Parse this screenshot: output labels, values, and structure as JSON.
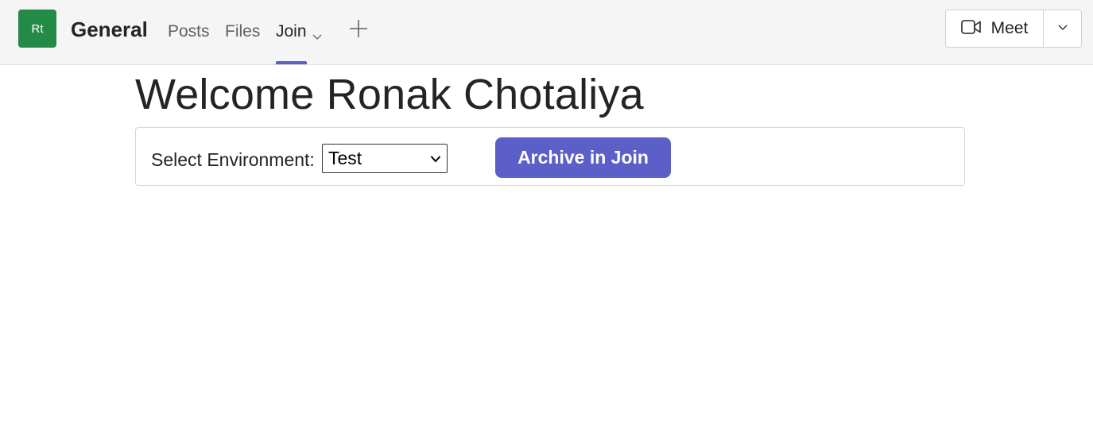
{
  "header": {
    "team_initials": "Rt",
    "channel_name": "General",
    "tabs": [
      {
        "label": "Posts",
        "active": false
      },
      {
        "label": "Files",
        "active": false
      },
      {
        "label": "Join",
        "active": true
      }
    ],
    "meet_label": "Meet"
  },
  "main": {
    "welcome_text": "Welcome Ronak Chotaliya",
    "environment_label": "Select Environment:",
    "environment_selected": "Test",
    "archive_button_label": "Archive in Join"
  },
  "colors": {
    "accent": "#5b5fc7",
    "team_avatar": "#238a47",
    "topbar_bg": "#f5f5f5"
  },
  "icons": {
    "add_tab": "plus-icon",
    "meet": "video-camera-icon",
    "meet_dropdown": "chevron-down-icon",
    "join_tab_dropdown": "chevron-down-icon",
    "environment_dropdown": "chevron-down-icon"
  }
}
